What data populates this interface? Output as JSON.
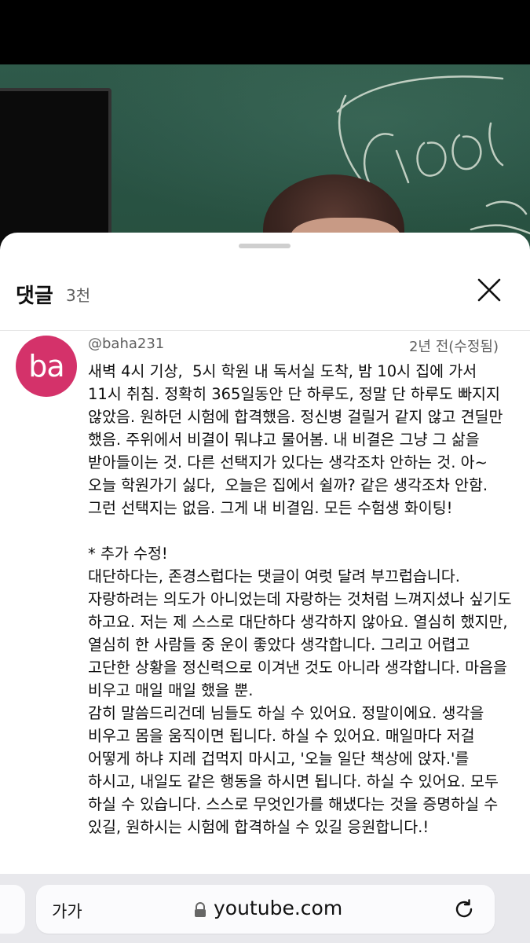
{
  "comments_panel": {
    "title": "댓글",
    "count": "3천",
    "close_icon": "close-icon"
  },
  "comment": {
    "avatar_text": "ba",
    "avatar_color": "#d4326a",
    "author": "@baha231",
    "time": "2년 전(수정됨)",
    "body": "새벽 4시 기상,  5시 학원 내 독서실 도착, 밤 10시 집에 가서 11시 취침. 정확히 365일동안 단 하루도, 정말 단 하루도 빠지지 않았음. 원하던 시험에 합격했음. 정신병 걸릴거 같지 않고 견딜만 했음. 주위에서 비결이 뭐냐고 물어봄. 내 비결은 그냥 그 삶을 받아들이는 것. 다른 선택지가 있다는 생각조차 안하는 것. 아~  오늘 학원가기 싫다,  오늘은 집에서 쉴까? 같은 생각조차 안함. 그런 선택지는 없음. 그게 내 비결임. 모든 수험생 화이팅!\n\n* 추가 수정!\n대단하다는, 존경스럽다는 댓글이 여럿 달려 부끄럽습니다. 자랑하려는 의도가 아니었는데 자랑하는 것처럼 느껴지셨나 싶기도 하고요. 저는 제 스스로 대단하다 생각하지 않아요. 열심히 했지만, 열심히 한 사람들 중 운이 좋았다 생각합니다. 그리고 어렵고 고단한 상황을 정신력으로 이겨낸 것도 아니라 생각합니다. 마음을 비우고 매일 매일 했을 뿐.\n감히 말씀드리건데 님들도 하실 수 있어요. 정말이에요. 생각을 비우고 몸을 움직이면 됩니다. 하실 수 있어요. 매일마다 저걸 어떻게 하냐 지레 겁먹지 마시고, '오늘 일단 책상에 앉자.'를 하시고, 내일도 같은 행동을 하시면 됩니다. 하실 수 있어요. 모두 하실 수 있습니다. 스스로 무엇인가를 해냈다는 것을 증명하실 수 있길, 원하시는 시험에 합격하실 수 있길 응원합니다.!"
  },
  "browser": {
    "text_size_label": "가가",
    "lock_icon": "lock-icon",
    "url": "youtube.com",
    "reload_icon": "reload-icon"
  },
  "video": {
    "chalk_text": "100"
  }
}
